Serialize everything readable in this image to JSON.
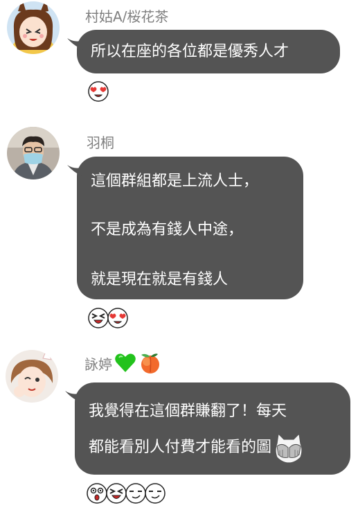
{
  "messages": [
    {
      "sender": "村姑A/桜花茶",
      "lines": [
        "所以在座的各位都是優秀人才"
      ],
      "reactions": [
        "heart-eyes-emoji"
      ]
    },
    {
      "sender": "羽桐",
      "lines": [
        "這個群組都是上流人士，",
        "不是成為有錢人中途，",
        "就是現在就是有錢人"
      ],
      "reactions": [
        "squint-laugh-emoji",
        "heart-eyes-emoji"
      ]
    },
    {
      "sender": "詠婷",
      "sender_emojis": [
        "green-heart-emoji",
        "peach-emoji"
      ],
      "lines": [
        "我覺得在這個群賺翻了！每天",
        "都能看別人付費才能看的圖"
      ],
      "inline_sticker": "cat-covering-face-sticker",
      "reactions": [
        "surprised-emoji",
        "squint-laugh-emoji",
        "smirk-emoji",
        "smirk-emoji"
      ]
    }
  ],
  "colors": {
    "bubble": "#545454",
    "bubble_text": "#ffffff",
    "sender_text": "#7f7f7f",
    "background": "#ffffff"
  }
}
